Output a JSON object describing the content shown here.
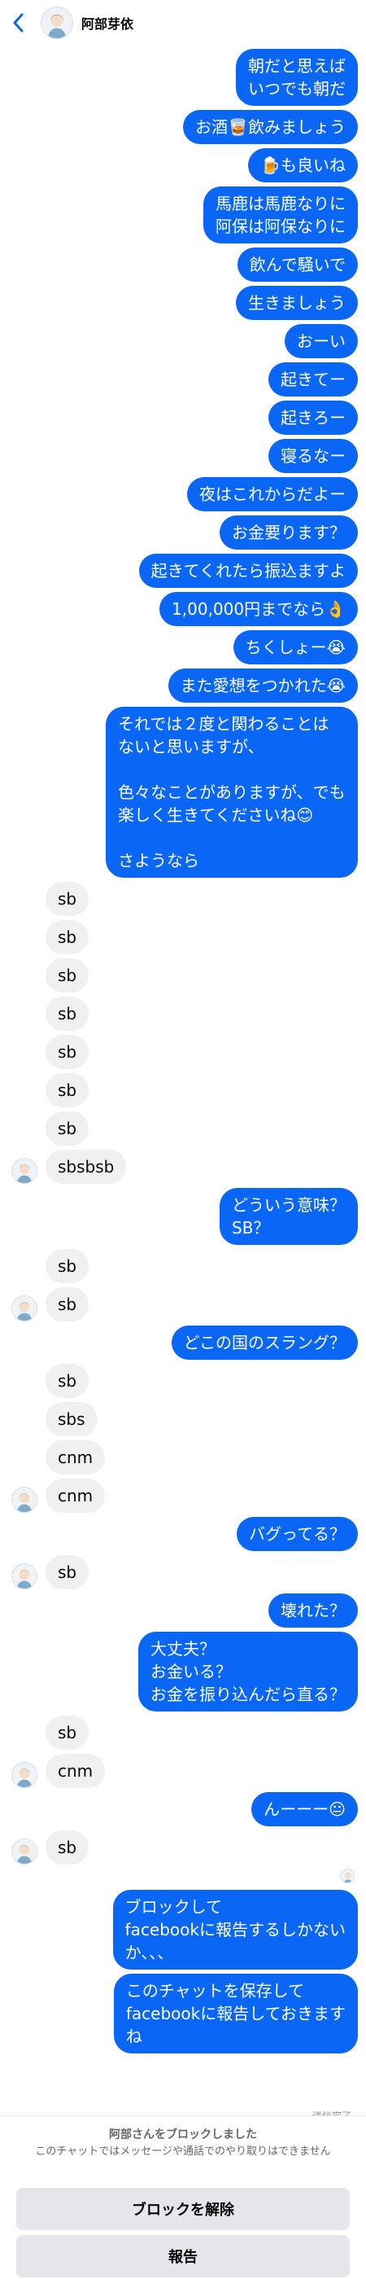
{
  "header": {
    "contact_name": "阿部芽依",
    "back_icon": "chevron-left-icon"
  },
  "messages": [
    {
      "from": "me",
      "text": "朝だと思えば\nいつでも朝だ"
    },
    {
      "from": "me",
      "text": "お酒🥃飲みましょう"
    },
    {
      "from": "me",
      "text": "🍺も良いね"
    },
    {
      "from": "me",
      "text": "馬鹿は馬鹿なりに\n阿保は阿保なりに"
    },
    {
      "from": "me",
      "text": "飲んで騒いで"
    },
    {
      "from": "me",
      "text": "生きましょう"
    },
    {
      "from": "me",
      "text": "おーい"
    },
    {
      "from": "me",
      "text": "起きてー"
    },
    {
      "from": "me",
      "text": "起きろー"
    },
    {
      "from": "me",
      "text": "寝るなー"
    },
    {
      "from": "me",
      "text": "夜はこれからだよー"
    },
    {
      "from": "me",
      "text": "お金要ります？"
    },
    {
      "from": "me",
      "text": "起きてくれたら振込ますよ"
    },
    {
      "from": "me",
      "text": "1,00,000円までなら👌"
    },
    {
      "from": "me",
      "text": "ちくしょー😭"
    },
    {
      "from": "me",
      "text": "また愛想をつかれた😭"
    },
    {
      "from": "me",
      "text": "それでは２度と関わることは\nないと思いますが、\n\n色々なことがありますが、でも楽しく生きてくださいね😊\n\nさようなら"
    },
    {
      "from": "them",
      "text": "sb",
      "avatar": false
    },
    {
      "from": "them",
      "text": "sb",
      "avatar": false
    },
    {
      "from": "them",
      "text": "sb",
      "avatar": false
    },
    {
      "from": "them",
      "text": "sb",
      "avatar": false
    },
    {
      "from": "them",
      "text": "sb",
      "avatar": false
    },
    {
      "from": "them",
      "text": "sb",
      "avatar": false
    },
    {
      "from": "them",
      "text": "sb",
      "avatar": false
    },
    {
      "from": "them",
      "text": "sbsbsb",
      "avatar": true
    },
    {
      "from": "me",
      "text": "どういう意味？\nSB？"
    },
    {
      "from": "them",
      "text": "sb",
      "avatar": false
    },
    {
      "from": "them",
      "text": "sb",
      "avatar": true
    },
    {
      "from": "me",
      "text": "どこの国のスラング？"
    },
    {
      "from": "them",
      "text": "sb",
      "avatar": false
    },
    {
      "from": "them",
      "text": "sbs",
      "avatar": false
    },
    {
      "from": "them",
      "text": "cnm",
      "avatar": false
    },
    {
      "from": "them",
      "text": "cnm",
      "avatar": true
    },
    {
      "from": "me",
      "text": "バグってる？"
    },
    {
      "from": "them",
      "text": "sb",
      "avatar": true
    },
    {
      "from": "me",
      "text": "壊れた？"
    },
    {
      "from": "me",
      "text": "大丈夫？\nお金いる？\nお金を振り込んだら直る？"
    },
    {
      "from": "them",
      "text": "sb",
      "avatar": false
    },
    {
      "from": "them",
      "text": "cnm",
      "avatar": true
    },
    {
      "from": "me",
      "text": "んーーー😐"
    },
    {
      "from": "them",
      "text": "sb",
      "avatar": true
    },
    {
      "from": "seen"
    },
    {
      "from": "me",
      "text": "ブロックして\nfacebookに報告するしかない\nか、、、"
    },
    {
      "from": "me",
      "text": "このチャットを保存して\nfacebookに報告しておきます\nね"
    }
  ],
  "status": {
    "sent_label": "送信完了"
  },
  "footer": {
    "blocked_title": "阿部さんをブロックしました",
    "blocked_subtitle": "このチャットではメッセージや通話でのやり取りはできません",
    "unblock_label": "ブロックを解除",
    "report_label": "報告"
  },
  "colors": {
    "my_bubble": "#0a66f5",
    "their_bubble": "#f0f0f0",
    "button_bg": "#e4e6eb"
  }
}
